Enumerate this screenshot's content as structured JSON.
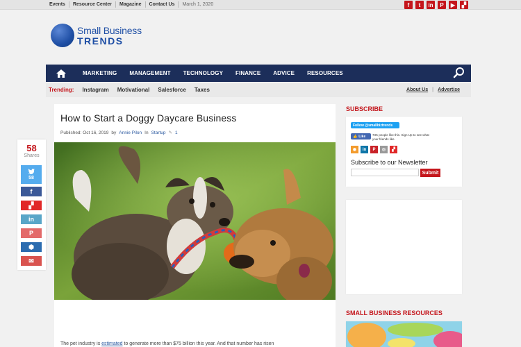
{
  "topbar": {
    "links": [
      "Events",
      "Resource Center",
      "Magazine",
      "Contact Us"
    ],
    "date": "March 1, 2020",
    "social_icons": [
      "facebook-icon",
      "twitter-icon",
      "linkedin-icon",
      "pinterest-icon",
      "youtube-icon",
      "flipboard-icon"
    ]
  },
  "logo": {
    "line1": "Small Business",
    "line2": "TRENDS"
  },
  "nav": {
    "items": [
      "MARKETING",
      "MANAGEMENT",
      "TECHNOLOGY",
      "FINANCE",
      "ADVICE",
      "RESOURCES"
    ]
  },
  "trending": {
    "label": "Trending:",
    "items": [
      "Instagram",
      "Motivational",
      "Salesforce",
      "Taxes"
    ],
    "about": "About Us",
    "advertise": "Advertise"
  },
  "share": {
    "count": "58",
    "label": "Shares",
    "twitter_count": "58",
    "buttons": [
      {
        "name": "facebook-share-button",
        "color": "#3b5998",
        "glyph": "f"
      },
      {
        "name": "flipboard-share-button",
        "color": "#e12828",
        "glyph": "▞"
      },
      {
        "name": "linkedin-share-button",
        "color": "#59a6c8",
        "glyph": "in"
      },
      {
        "name": "pinterest-share-button",
        "color": "#e36a6a",
        "glyph": "P"
      },
      {
        "name": "buffer-share-button",
        "color": "#2b6cb0",
        "glyph": "⬢"
      },
      {
        "name": "email-share-button",
        "color": "#d9534f",
        "glyph": "✉"
      }
    ]
  },
  "article": {
    "title": "How to Start a Doggy Daycare Business",
    "published": "Published: Oct 16, 2019",
    "by": "by",
    "author": "Annie Pilon",
    "in": "In",
    "category": "Startup",
    "comments": "1",
    "body_pre": "The pet industry is ",
    "body_link": "estimated",
    "body_post": " to generate more than $75 billion this year. And that number has risen"
  },
  "sidebar": {
    "subscribe_title": "SUBSCRIBE",
    "twitter_follow": "Follow @smallbiztrends",
    "fb_like": "Like",
    "fb_text": "73K people like this. Sign Up to see what your friends like.",
    "newsletter_title": "Subscribe to our Newsletter",
    "newsletter_placeholder": "",
    "submit_label": "Submit",
    "resources_title": "SMALL BUSINESS RESOURCES"
  },
  "colors": {
    "brand_red": "#c4161c",
    "nav_blue": "#1c2e5a",
    "logo_blue": "#1f4fa5"
  }
}
